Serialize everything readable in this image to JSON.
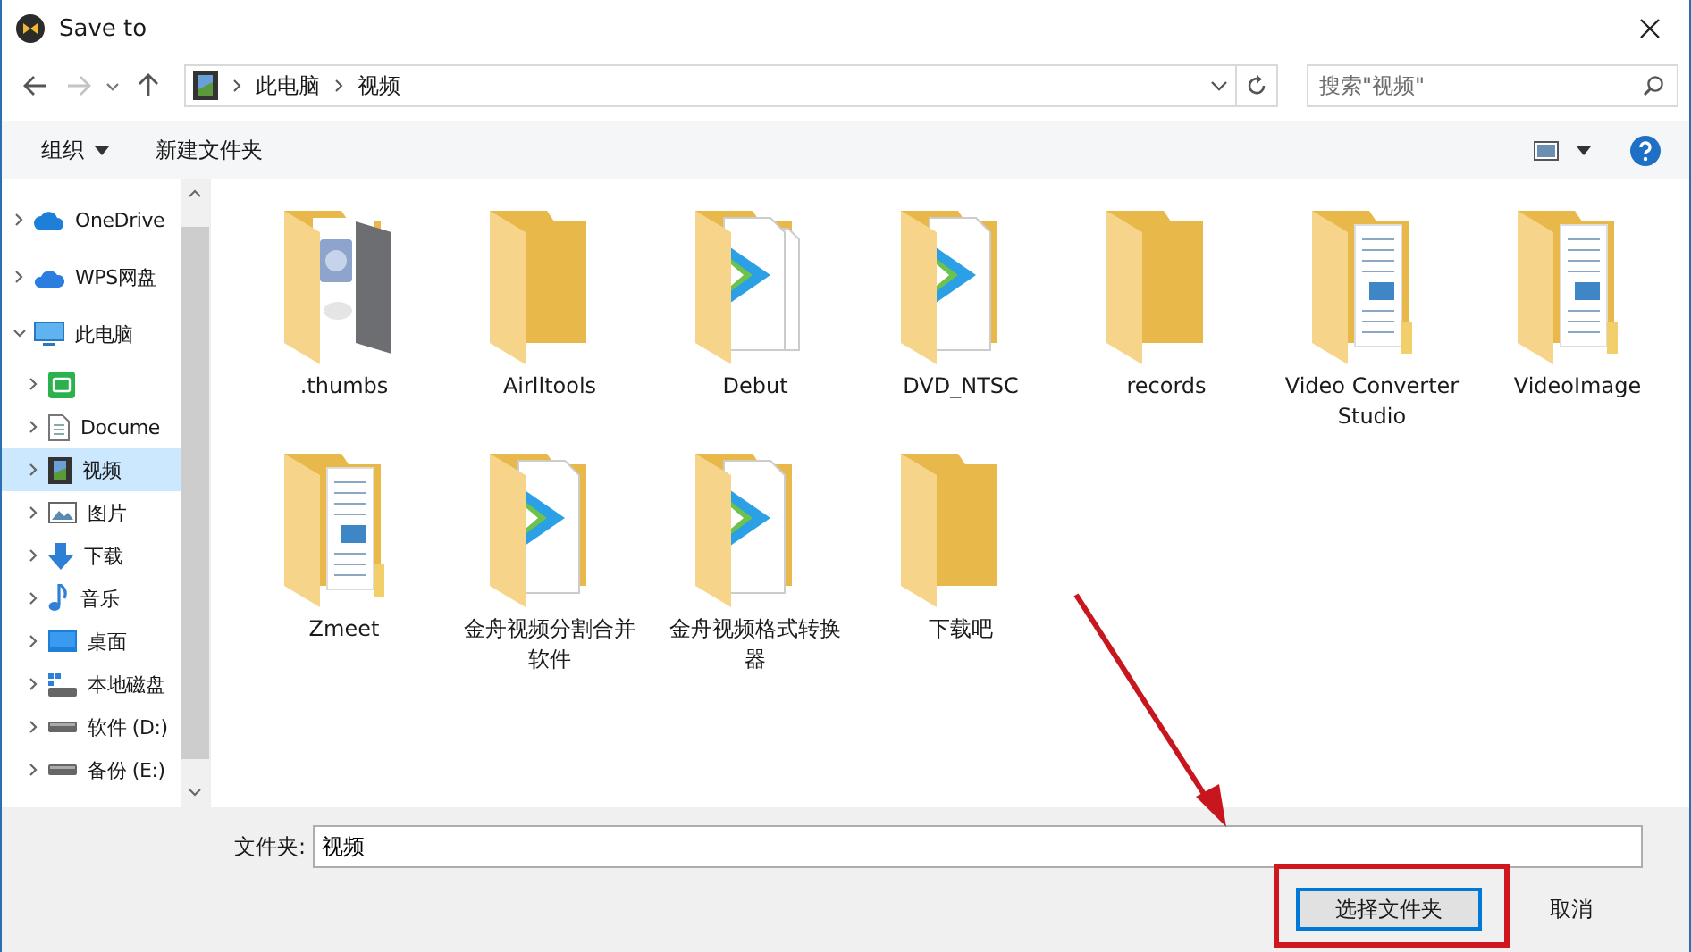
{
  "window": {
    "title": "Save to"
  },
  "nav": [
    {
      "kind": "back",
      "disabled": false
    },
    {
      "kind": "forward",
      "disabled": true
    },
    {
      "kind": "recent",
      "disabled": false
    },
    {
      "kind": "up",
      "disabled": false
    }
  ],
  "address": {
    "path": [
      "此电脑",
      "视频"
    ]
  },
  "search": {
    "placeholder": "搜索\"视频\""
  },
  "toolbar": {
    "organize": "组织",
    "new_folder": "新建文件夹"
  },
  "sidebar": {
    "items": [
      {
        "label": "OneDrive",
        "kind": "cloud",
        "expanded": false,
        "selected": false
      },
      {
        "label": "WPS网盘",
        "kind": "wps",
        "expanded": false,
        "selected": false
      },
      {
        "label": "此电脑",
        "kind": "pc",
        "expanded": true,
        "selected": false,
        "children": [
          {
            "kind": "app",
            "expanded": false,
            "selected": false
          },
          {
            "label": "Docume",
            "kind": "document",
            "expanded": false,
            "selected": false
          },
          {
            "label": "视频",
            "kind": "video",
            "expanded": false,
            "selected": true
          },
          {
            "label": "图片",
            "kind": "pictures",
            "expanded": false,
            "selected": false
          },
          {
            "label": "下载",
            "kind": "downloads",
            "expanded": false,
            "selected": false
          },
          {
            "label": "音乐",
            "kind": "music",
            "expanded": false,
            "selected": false
          },
          {
            "label": "桌面",
            "kind": "desktop",
            "expanded": false,
            "selected": false
          },
          {
            "label": "本地磁盘",
            "kind": "system-disk",
            "expanded": false,
            "selected": false
          },
          {
            "label": "软件 (D:)",
            "kind": "drive",
            "expanded": false,
            "selected": false
          },
          {
            "label": "备份 (E:)",
            "kind": "drive",
            "expanded": false,
            "selected": false
          }
        ]
      }
    ]
  },
  "files": [
    {
      "name": ".thumbs",
      "kind": "thumbs"
    },
    {
      "name": "Airlltools",
      "kind": "plain"
    },
    {
      "name": "Debut",
      "kind": "mov2"
    },
    {
      "name": "DVD_NTSC",
      "kind": "mov"
    },
    {
      "name": "records",
      "kind": "plain"
    },
    {
      "name": "Video Converter Studio",
      "kind": "documents"
    },
    {
      "name": "VideoImage",
      "kind": "documents"
    },
    {
      "name": "Zmeet",
      "kind": "documents"
    },
    {
      "name": "金舟视频分割合并软件",
      "kind": "mp4"
    },
    {
      "name": "金舟视频格式转换器",
      "kind": "video"
    },
    {
      "name": "下载吧",
      "kind": "plain"
    }
  ],
  "footer": {
    "folder_label": "文件夹:",
    "folder_value": "视频",
    "buttons": [
      {
        "label": "选择文件夹",
        "kind": "primary"
      },
      {
        "label": "取消",
        "kind": "secondary"
      }
    ]
  }
}
